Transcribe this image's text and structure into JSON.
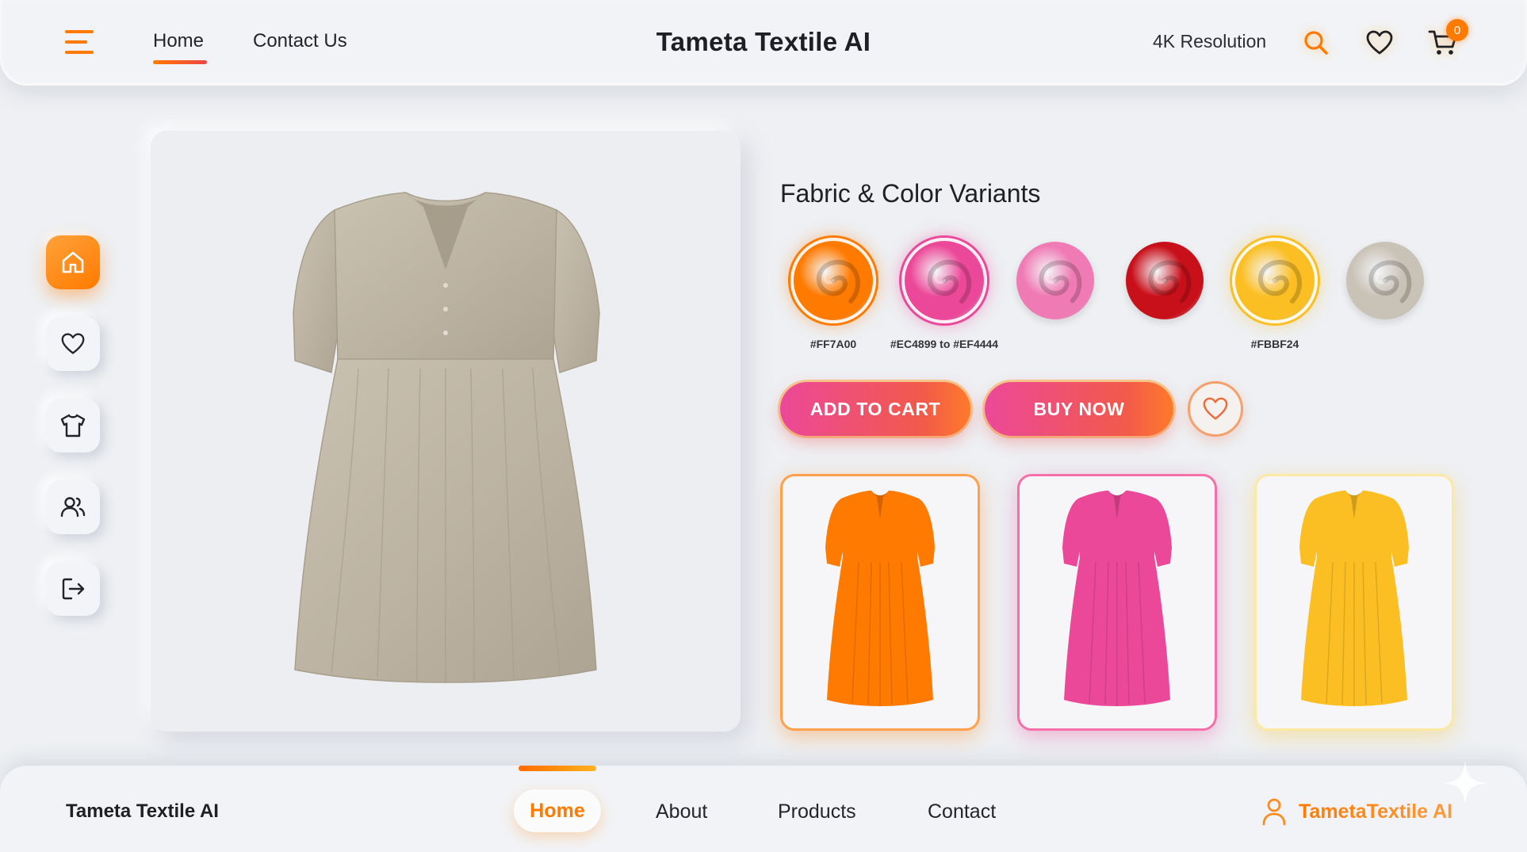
{
  "colors": {
    "accent_orange": "#FF7A00",
    "accent_pink": "#EC4899",
    "accent_red": "#EF4444",
    "accent_yellow": "#FBBF24",
    "background": "#EEF0F3"
  },
  "header": {
    "menu_icon": "hamburger-menu-icon",
    "nav": [
      {
        "label": "Home",
        "active": true
      },
      {
        "label": "Contact Us",
        "active": false
      }
    ],
    "title": "Tameta Textile AI",
    "resolution_label": "4K Resolution",
    "icons": [
      "search-icon",
      "heart-icon",
      "cart-icon"
    ],
    "cart_count": "0"
  },
  "sidebar": {
    "items": [
      {
        "icon": "home-icon",
        "active": true
      },
      {
        "icon": "heart-icon",
        "active": false
      },
      {
        "icon": "shirt-icon",
        "active": false
      },
      {
        "icon": "users-icon",
        "active": false
      },
      {
        "icon": "logout-icon",
        "active": false
      }
    ]
  },
  "product": {
    "image": "beige-linen-dress-image"
  },
  "variants": {
    "title": "Fabric & Color Variants",
    "swatches": [
      {
        "color": "#FF7A00",
        "label": "#FF7A00",
        "selected": true
      },
      {
        "color": "#EC4899",
        "label": "#EC4899 to #EF4444",
        "selected": true
      },
      {
        "color": "#F07AB4",
        "label": "",
        "selected": false
      },
      {
        "color": "#C8101A",
        "label": "",
        "selected": false
      },
      {
        "color": "#FBBF24",
        "label": "#FBBF24",
        "selected": true
      },
      {
        "color": "#C9C2B6",
        "label": "",
        "selected": false
      }
    ],
    "thumbnails": [
      {
        "color": "#FF7A00",
        "image": "orange-dress-image"
      },
      {
        "color": "#EC4899",
        "image": "pink-dress-image"
      },
      {
        "color": "#FBBF24",
        "image": "yellow-dress-image"
      }
    ]
  },
  "actions": {
    "add_to_cart": "ADD TO CART",
    "buy_now": "BUY NOW",
    "wishlist_icon": "heart-icon"
  },
  "footer": {
    "brand": "Tameta Textile AI",
    "nav": [
      {
        "label": "Home",
        "active": true
      },
      {
        "label": "About",
        "active": false
      },
      {
        "label": "Products",
        "active": false
      },
      {
        "label": "Contact",
        "active": false
      }
    ],
    "user_label": "TametaTextile AI",
    "user_icon": "user-icon"
  }
}
